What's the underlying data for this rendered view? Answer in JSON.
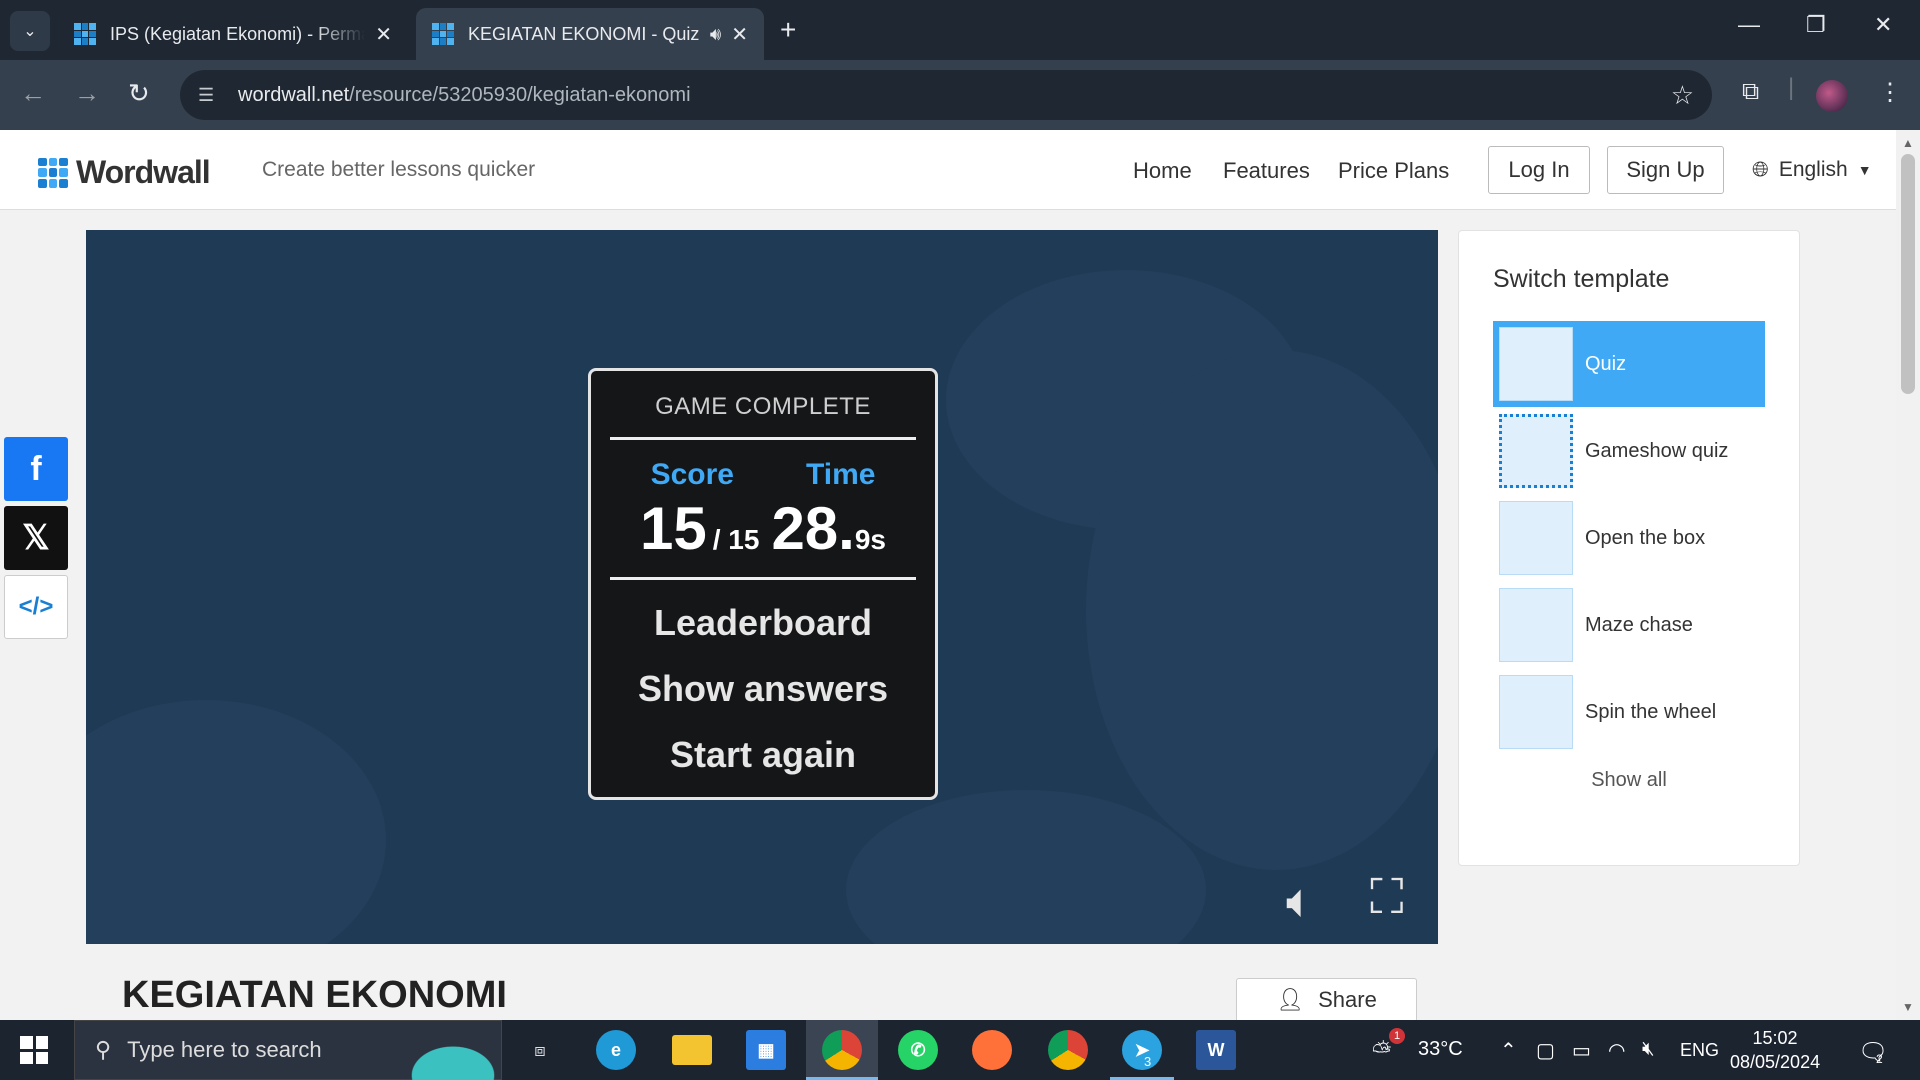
{
  "browser": {
    "tabs": [
      {
        "title": "IPS (Kegiatan Ekonomi) - Perma",
        "active": false
      },
      {
        "title": "KEGIATAN EKONOMI - Quiz",
        "active": true
      }
    ],
    "url_host": "wordwall.net",
    "url_path": "/resource/53205930/kegiatan-ekonomi"
  },
  "site": {
    "logo": "Wordwall",
    "tagline": "Create better lessons quicker",
    "nav": [
      "Home",
      "Features",
      "Price Plans"
    ],
    "login": "Log In",
    "signup": "Sign Up",
    "language": "English"
  },
  "game": {
    "panel_title": "GAME COMPLETE",
    "score_label": "Score",
    "time_label": "Time",
    "score": "15",
    "score_total": "/ 15",
    "time_whole": "28.",
    "time_frac": "9s",
    "menu": [
      "Leaderboard",
      "Show answers",
      "Start again"
    ]
  },
  "sidebar": {
    "title": "Switch template",
    "templates": [
      {
        "label": "Quiz",
        "selected": true
      },
      {
        "label": "Gameshow quiz",
        "selected": false
      },
      {
        "label": "Open the box",
        "selected": false
      },
      {
        "label": "Maze chase",
        "selected": false
      },
      {
        "label": "Spin the wheel",
        "selected": false
      }
    ],
    "show_all": "Show all"
  },
  "activity": {
    "title": "KEGIATAN EKONOMI",
    "share": "Share"
  },
  "taskbar": {
    "search_placeholder": "Type here to search",
    "temperature": "33°C",
    "language": "ENG",
    "time": "15:02",
    "date": "08/05/2024",
    "telegram_badge": "3",
    "weather_badge": "1",
    "notification_badge": "2"
  },
  "colors": {
    "accent": "#3fa9f5",
    "game_bg": "#1f3a55",
    "facebook": "#1877f2",
    "x": "#111111"
  }
}
